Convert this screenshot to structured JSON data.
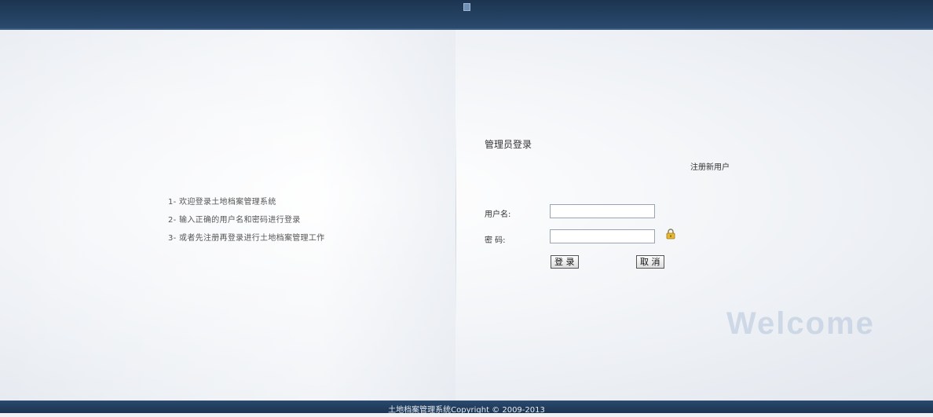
{
  "login": {
    "title": "管理员登录",
    "register_link": "注册新用户",
    "username_label": "用户名:",
    "username_value": "",
    "password_label": "密 码:",
    "password_value": "",
    "login_button": "登 录",
    "cancel_button": "取 消"
  },
  "tips": [
    "1- 欢迎登录土地档案管理系统",
    "2- 输入正确的用户名和密码进行登录",
    "3- 或者先注册再登录进行土地档案管理工作"
  ],
  "watermark": "Welcome",
  "footer": {
    "copyright": "土地档案管理系统Copyright © 2009-2013"
  },
  "icons": {
    "lock": "lock-icon"
  },
  "colors": {
    "header": "#1c3450",
    "footer": "#1c3450",
    "watermark": "#b4c4da"
  }
}
